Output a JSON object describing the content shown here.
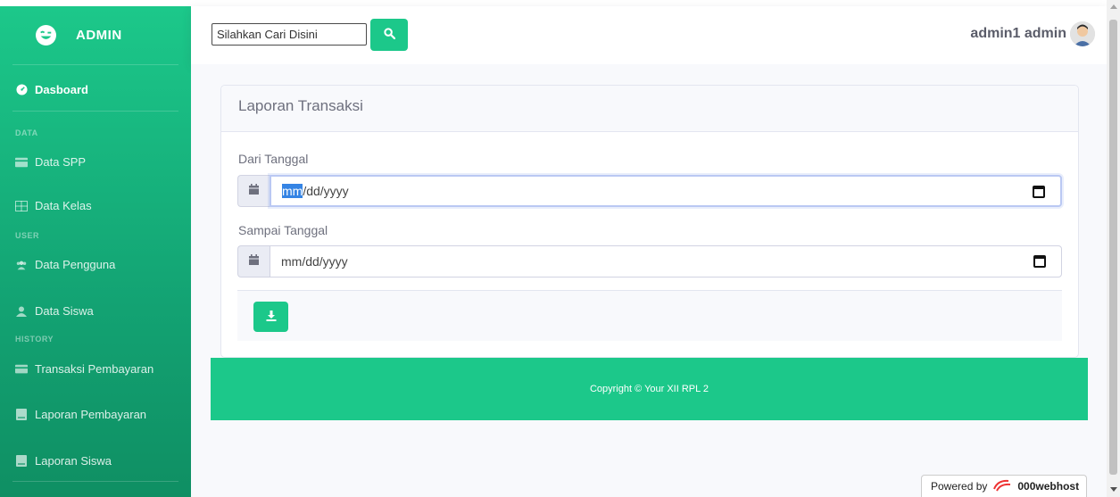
{
  "sidebar": {
    "brand": "ADMIN",
    "items": [
      {
        "label": "Dasboard",
        "icon": "dashboard-icon"
      },
      {
        "heading": "DATA"
      },
      {
        "label": "Data SPP",
        "icon": "card-icon"
      },
      {
        "label": "Data Kelas",
        "icon": "table-icon"
      },
      {
        "heading": "USER"
      },
      {
        "label": "Data Pengguna",
        "icon": "users-icon"
      },
      {
        "label": "Data Siswa",
        "icon": "user-icon"
      },
      {
        "heading": "HISTORY"
      },
      {
        "label": "Transaksi Pembayaran",
        "icon": "money-icon"
      },
      {
        "label": "Laporan Pembayaran",
        "icon": "book-icon"
      },
      {
        "label": "Laporan Siswa",
        "icon": "book-icon"
      }
    ]
  },
  "topbar": {
    "search_placeholder": "Silahkan Cari Disini",
    "user_name": "admin1 admin"
  },
  "card": {
    "title": "Laporan Transaksi",
    "from_label": "Dari Tanggal",
    "to_label": "Sampai Tanggal",
    "date_mm": "mm",
    "date_rest": "/dd/yyyy",
    "date_placeholder": "mm/dd/yyyy"
  },
  "footer": {
    "copyright": "Copyright © Your XII RPL 2"
  },
  "powered": {
    "prefix": "Powered by",
    "brand": "000webhost"
  },
  "colors": {
    "primary": "#1cc88a",
    "sidebar_dark": "#0f8f63"
  }
}
